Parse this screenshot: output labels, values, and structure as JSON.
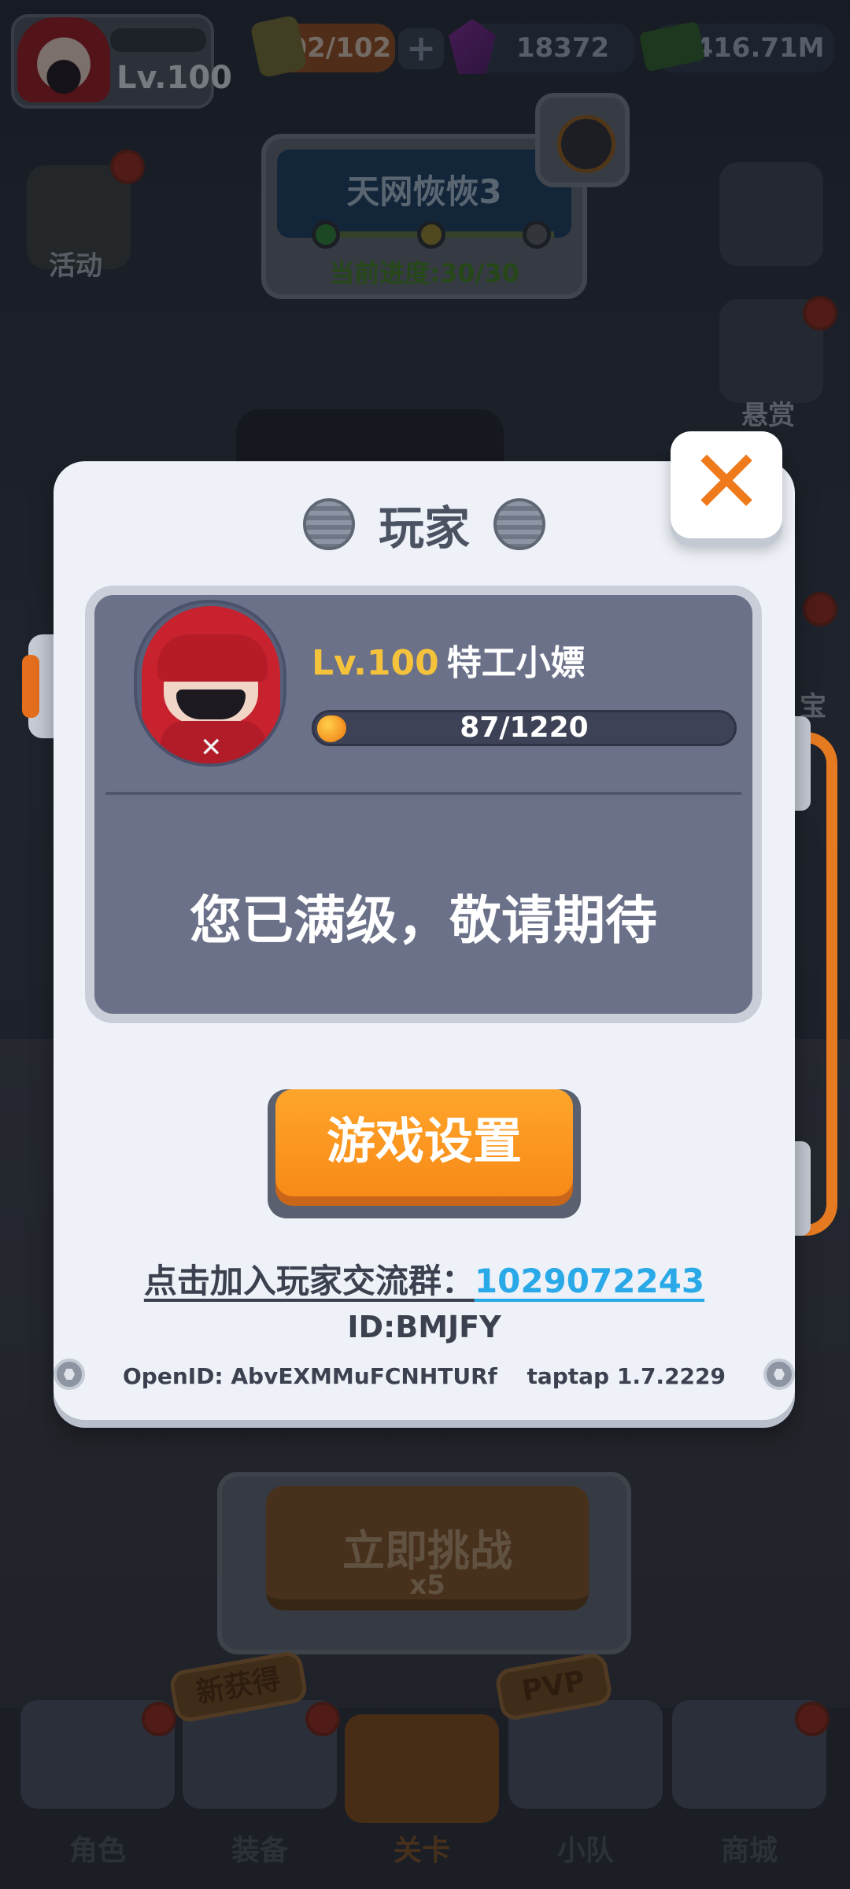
{
  "hud": {
    "level": "Lv.100",
    "energy": "102/102",
    "plus": "+",
    "gems": "18372",
    "cash": "416.71M"
  },
  "stage": {
    "title": "天网恢恢3",
    "progress": "当前进度:30/30"
  },
  "side": {
    "activity": "活动",
    "bounty": "悬赏",
    "treasure": "宝"
  },
  "dialog": {
    "title": "玩家",
    "close_symbol": "✕",
    "player": {
      "level": "Lv.100",
      "name": "特工小嫖",
      "xp_text": "87/1220",
      "xp_fraction": 0.071
    },
    "max_level_message": "您已满级，敬请期待",
    "settings_button": "游戏设置",
    "join_label": "点击加入玩家交流群：",
    "join_number": "1029072243",
    "id": "ID:BMJFY",
    "open_id": "OpenID: AbvEXMMuFCNHTURf",
    "version": "taptap 1.7.2229"
  },
  "challenge": {
    "label": "立即挑战",
    "cost": "x5"
  },
  "tags": {
    "new": "新获得",
    "pvp": "PVP"
  },
  "nav": {
    "items": [
      {
        "label": "角色"
      },
      {
        "label": "装备"
      },
      {
        "label": "关卡"
      },
      {
        "label": "小队"
      },
      {
        "label": "商城"
      }
    ],
    "active_index": 2
  },
  "colors": {
    "accent_orange": "#f88a18",
    "level_gold": "#f5c23c",
    "link_blue": "#2aa9e8"
  }
}
